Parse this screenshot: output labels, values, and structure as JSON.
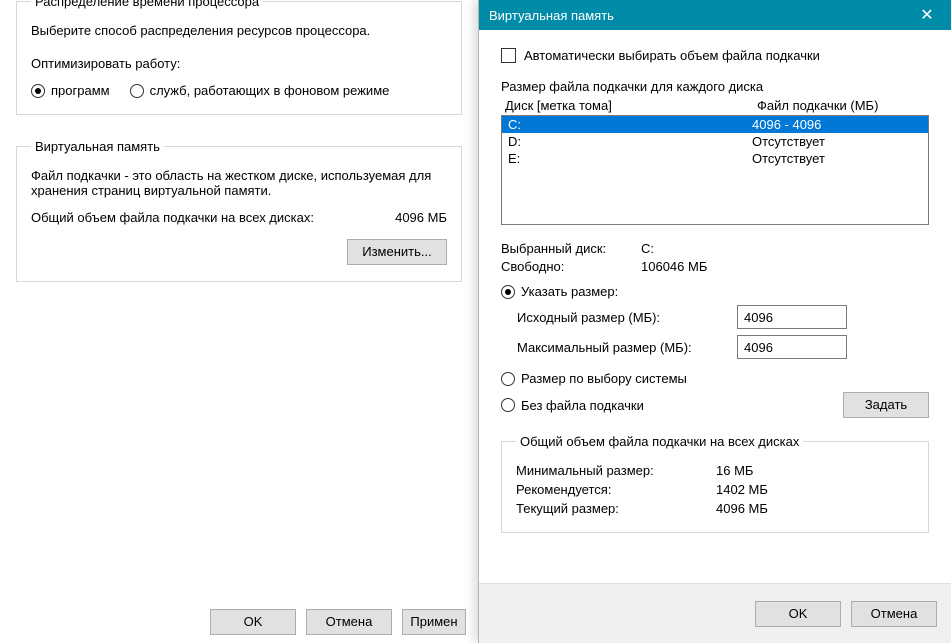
{
  "perf": {
    "group1_title": "Распределение времени процессора",
    "desc": "Выберите способ распределения ресурсов процессора.",
    "optimize": "Оптимизировать работу:",
    "opt_programs": "программ",
    "opt_services": "служб, работающих в фоновом режиме",
    "group2_title": "Виртуальная память",
    "vm_desc": "Файл подкачки - это область на жестком диске, используемая для хранения страниц виртуальной памяти.",
    "total_label": "Общий объем файла подкачки на всех дисках:",
    "total_value": "4096 МБ",
    "change_btn": "Изменить...",
    "ok": "OK",
    "cancel": "Отмена",
    "apply": "Примен"
  },
  "vm": {
    "title": "Виртуальная память",
    "auto_chk": "Автоматически выбирать объем файла подкачки",
    "list_label": "Размер файла подкачки для каждого диска",
    "col_disk": "Диск [метка тома]",
    "col_pf": "Файл подкачки (МБ)",
    "drives": [
      {
        "name": "C:",
        "pf": "4096 - 4096",
        "selected": true
      },
      {
        "name": "D:",
        "pf": "Отсутствует",
        "selected": false
      },
      {
        "name": "E:",
        "pf": "Отсутствует",
        "selected": false
      }
    ],
    "sel_drive_lbl": "Выбранный диск:",
    "sel_drive_val": "C:",
    "free_lbl": "Свободно:",
    "free_val": "106046 МБ",
    "custom_size": "Указать размер:",
    "init_lbl": "Исходный размер (МБ):",
    "init_val": "4096",
    "max_lbl": "Максимальный размер (МБ):",
    "max_val": "4096",
    "system_size": "Размер по выбору системы",
    "no_pf": "Без файла подкачки",
    "set_btn": "Задать",
    "total_group": "Общий объем файла подкачки на всех дисках",
    "min_lbl": "Минимальный размер:",
    "min_val": "16 МБ",
    "rec_lbl": "Рекомендуется:",
    "rec_val": "1402 МБ",
    "cur_lbl": "Текущий размер:",
    "cur_val": "4096 МБ",
    "ok": "OK",
    "cancel": "Отмена"
  }
}
